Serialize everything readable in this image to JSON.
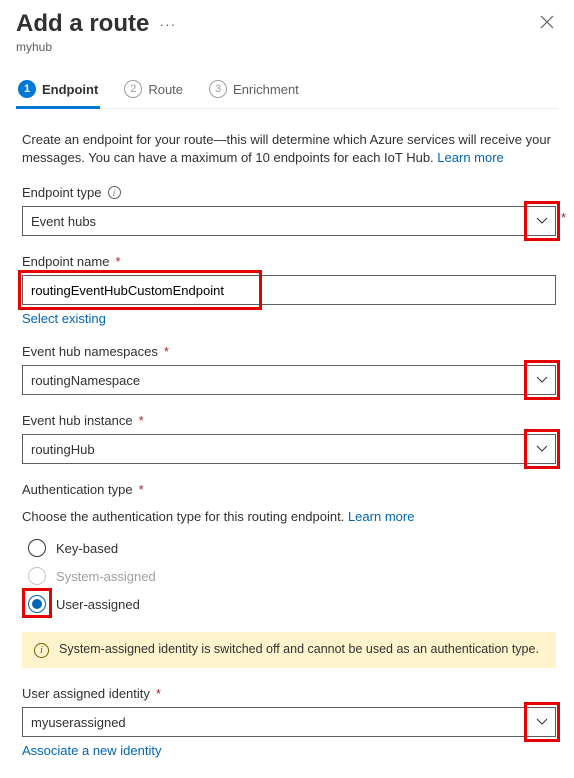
{
  "header": {
    "title": "Add a route",
    "subtitle": "myhub"
  },
  "tabs": {
    "t1": {
      "num": "1",
      "label": "Endpoint"
    },
    "t2": {
      "num": "2",
      "label": "Route"
    },
    "t3": {
      "num": "3",
      "label": "Enrichment"
    }
  },
  "intro": {
    "text": "Create an endpoint for your route—this will determine which Azure services will receive your messages. You can have a maximum of 10 endpoints for each IoT Hub. ",
    "learn_more": "Learn more"
  },
  "fields": {
    "endpoint_type": {
      "label": "Endpoint type",
      "value": "Event hubs"
    },
    "endpoint_name": {
      "label": "Endpoint name",
      "value": "routingEventHubCustomEndpoint",
      "select_existing": "Select existing"
    },
    "namespaces": {
      "label": "Event hub namespaces",
      "value": "routingNamespace"
    },
    "instance": {
      "label": "Event hub instance",
      "value": "routingHub"
    },
    "auth": {
      "label": "Authentication type",
      "desc": "Choose the authentication type for this routing endpoint. ",
      "learn_more": "Learn more",
      "opts": {
        "key": "Key-based",
        "sys": "System-assigned",
        "user": "User-assigned"
      },
      "banner": "System-assigned identity is switched off and cannot be used as an authentication type."
    },
    "identity": {
      "label": "User assigned identity",
      "value": "myuserassigned",
      "associate": "Associate a new identity"
    }
  }
}
